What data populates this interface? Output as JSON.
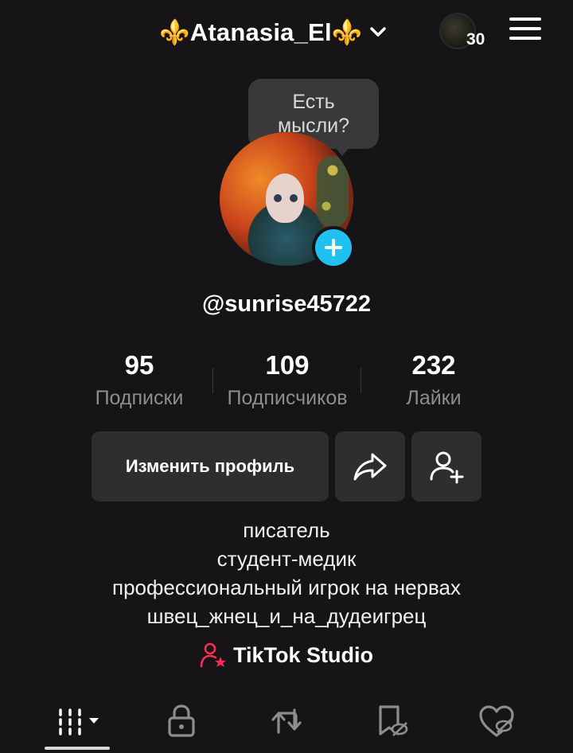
{
  "header": {
    "account_name": "⚜️Atanasia_El⚜️",
    "notification_count": "30"
  },
  "bubble": {
    "line1": "Есть",
    "line2": "мысли?"
  },
  "profile": {
    "username": "@sunrise45722"
  },
  "stats": [
    {
      "value": "95",
      "label": "Подписки"
    },
    {
      "value": "109",
      "label": "Подписчиков"
    },
    {
      "value": "232",
      "label": "Лайки"
    }
  ],
  "actions": {
    "edit_label": "Изменить профиль"
  },
  "bio": [
    "писатель",
    "студент-медик",
    "профессиональный игрок на нервах",
    "швец_жнец_и_на_дудеигрец"
  ],
  "studio": {
    "label": "TikTok Studio"
  },
  "tabs": [
    "grid-icon",
    "lock-icon",
    "repost-icon",
    "favorites-icon",
    "liked-icon"
  ],
  "colors": {
    "accent": "#20c0f0",
    "studio": "#fe2c55",
    "background": "#161416",
    "button": "#2f2d2f"
  }
}
